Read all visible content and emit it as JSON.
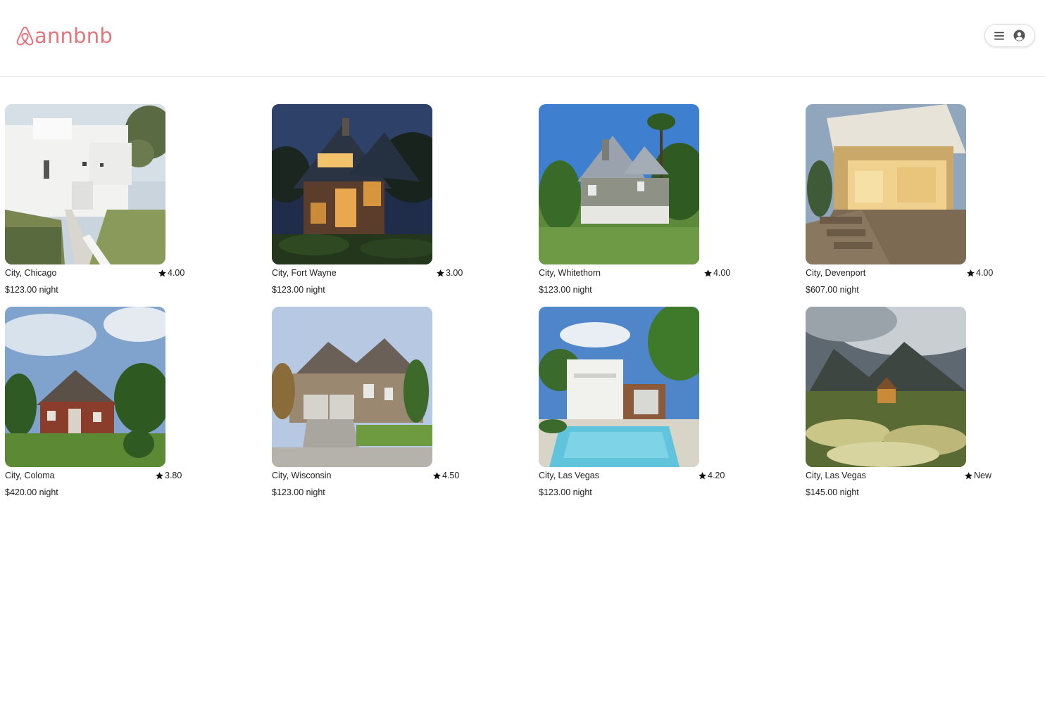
{
  "header": {
    "logo_text": "annbnb",
    "brand_color": "#e8737b",
    "menu_icon": "hamburger-icon",
    "user_icon": "user-circle-icon"
  },
  "listings": [
    {
      "city": "City, Chicago",
      "rating": "4.00",
      "price": "$123.00 night",
      "photo": "white-modern-house"
    },
    {
      "city": "City, Fort Wayne",
      "rating": "3.00",
      "price": "$123.00 night",
      "photo": "a-frame-house-night"
    },
    {
      "city": "City, Whitethorn",
      "rating": "4.00",
      "price": "$123.00 night",
      "photo": "grey-cottage-palms"
    },
    {
      "city": "City, Devenport",
      "rating": "4.00",
      "price": "$607.00 night",
      "photo": "deck-patio-evening"
    },
    {
      "city": "City, Coloma",
      "rating": "3.80",
      "price": "$420.00 night",
      "photo": "brick-house-lawn"
    },
    {
      "city": "City, Wisconsin",
      "rating": "4.50",
      "price": "$123.00 night",
      "photo": "stone-suburban-house"
    },
    {
      "city": "City, Las Vegas",
      "rating": "4.20",
      "price": "$123.00 night",
      "photo": "white-house-pool"
    },
    {
      "city": "City, Las Vegas",
      "rating": "New",
      "price": "$145.00 night",
      "photo": "cabin-wildflowers-mountain"
    }
  ]
}
